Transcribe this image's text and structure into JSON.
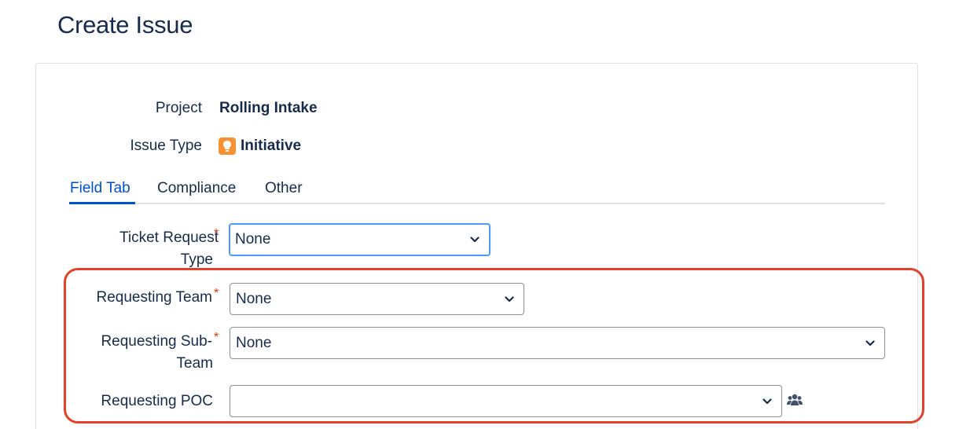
{
  "page": {
    "title": "Create Issue"
  },
  "project": {
    "label": "Project",
    "value": "Rolling Intake"
  },
  "issue_type": {
    "label": "Issue Type",
    "value": "Initiative",
    "icon": "lightbulb-icon",
    "icon_color": "#f79232"
  },
  "tabs": [
    {
      "label": "Field Tab",
      "active": true
    },
    {
      "label": "Compliance",
      "active": false
    },
    {
      "label": "Other",
      "active": false
    }
  ],
  "fields": {
    "ticket_request_type": {
      "label_line1": "Ticket Request",
      "label_line2": "Type",
      "required_mark": "*",
      "value": "None"
    },
    "requesting_team": {
      "label": "Requesting Team",
      "required_mark": "*",
      "value": "None"
    },
    "requesting_sub_team": {
      "label_line1": "Requesting Sub-",
      "label_line2": "Team",
      "required_mark": "*",
      "value": "None"
    },
    "requesting_poc": {
      "label": "Requesting POC",
      "value": "",
      "picker_icon": "people-icon"
    }
  },
  "colors": {
    "accent": "#0052cc",
    "focus_ring": "#4c9aff",
    "required": "#de350b",
    "highlight": "#e2412a",
    "text": "#172b4d"
  }
}
